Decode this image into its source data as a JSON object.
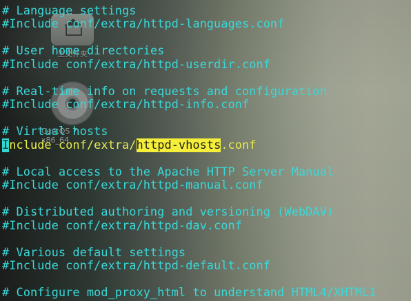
{
  "desktop": {
    "home_icon_label": "主文件夹",
    "disc_icon_label": "CentOS 7 x86_64"
  },
  "terminal": {
    "lines": [
      "# Language settings",
      "#Include conf/extra/httpd-languages.conf",
      "",
      "# User home directories",
      "#Include conf/extra/httpd-userdir.conf",
      "",
      "# Real-time info on requests and configuration",
      "#Include conf/extra/httpd-info.conf",
      "",
      "# Virtual hosts",
      "",
      "",
      "# Local access to the Apache HTTP Server Manual",
      "#Include conf/extra/httpd-manual.conf",
      "",
      "# Distributed authoring and versioning (WebDAV)",
      "#Include conf/extra/httpd-dav.conf",
      "",
      "# Various default settings",
      "#Include conf/extra/httpd-default.conf",
      "",
      "# Configure mod_proxy_html to understand HTML4/XHTML1"
    ],
    "active_line": {
      "cursor_char": "I",
      "keyword_rest": "nclude",
      "path_prefix": " conf/extra/",
      "search_match": "httpd-vhosts",
      "path_suffix": ".conf"
    }
  },
  "colors": {
    "comment_text": "#3ad8d8",
    "keyword": "#eef04a",
    "search_highlight": "#f5ef3a",
    "cursor": "#31d7d0"
  }
}
